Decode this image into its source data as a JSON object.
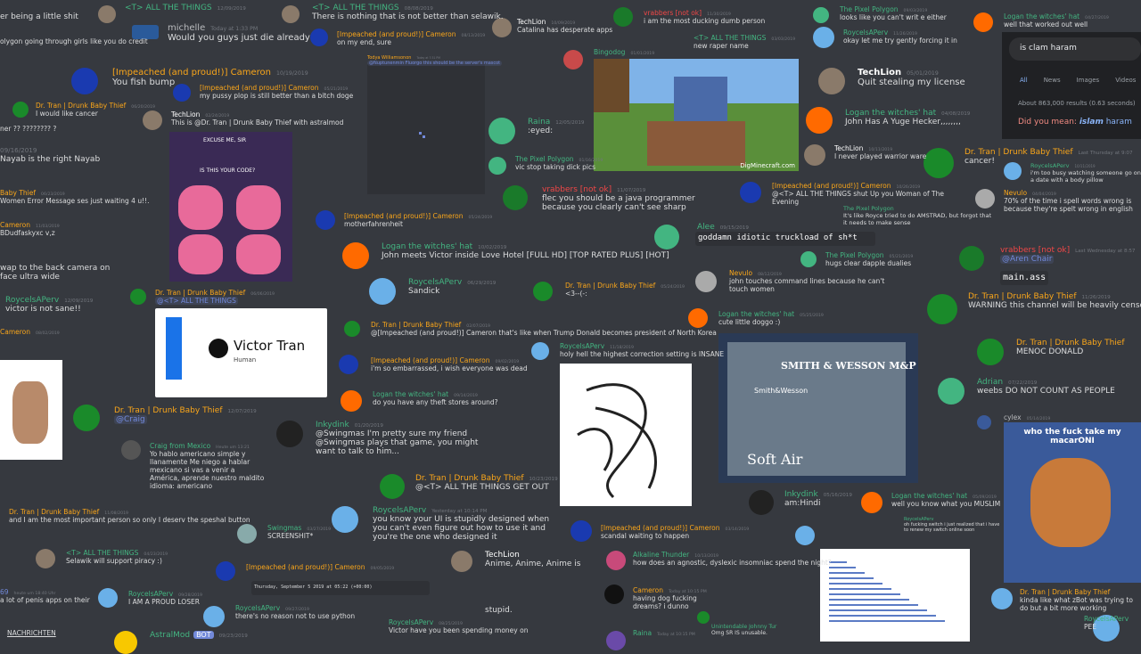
{
  "messages": [
    {
      "id": "m1",
      "name": "",
      "time": "",
      "text": "er being a little shit",
      "color": "#dcddde"
    },
    {
      "id": "m2",
      "name": "",
      "time": "",
      "text": "olygon going through girls like you do credit",
      "color": "#dcddde"
    },
    {
      "id": "m3",
      "name": "<T> ALL THE THINGS",
      "time": "12/09/2019",
      "text": "",
      "color": "#43b581"
    },
    {
      "id": "m4",
      "name": "michelle",
      "time": "Today at 1:33 PM",
      "text": "Would you guys just die already",
      "color": "#b9bbbe"
    },
    {
      "id": "m5",
      "name": "<T> ALL THE THINGS",
      "time": "08/08/2019",
      "text": "There is nothing that is not better than selawik.",
      "color": "#43b581"
    },
    {
      "id": "m6",
      "name": "[Impeached (and proud!)] Cameron",
      "time": "08/13/2019",
      "text": "on my end, sure",
      "color": "#faa61a"
    },
    {
      "id": "m7",
      "name": "TechLion",
      "time": "10/09/2019",
      "text": "Catalina has desperate apps",
      "color": "#ffffff"
    },
    {
      "id": "m8",
      "name": "vrabbers [not ok]",
      "time": "11/30/2019",
      "text": "i am the most ducking dumb person",
      "color": "#f04747"
    },
    {
      "id": "m9",
      "name": "The Pixel Polygon",
      "time": "09/03/2019",
      "text": "looks like you can't writ e either",
      "color": "#43b581"
    },
    {
      "id": "m10",
      "name": "Logan the witches' hat",
      "time": "04/27/2019",
      "text": "well that worked out well",
      "color": "#43b581"
    },
    {
      "id": "m11",
      "name": "<T> ALL THE THINGS",
      "time": "03/03/2019",
      "text": "new raper name",
      "color": "#43b581"
    },
    {
      "id": "m12",
      "name": "RoycelsAPerv",
      "time": "11/26/2019",
      "text": "okay let me try gently forcing it in",
      "color": "#43b581"
    },
    {
      "id": "m13",
      "name": "Todya Williamsonon",
      "time": "Today at 7:31 PM",
      "text": "@Nuptunenmin Fluorgo this should be the server's mascot",
      "color": "#faa61a"
    },
    {
      "id": "m14",
      "name": "Bingodog",
      "time": "01/01/2019",
      "text": "",
      "color": "#43b581"
    },
    {
      "id": "m15",
      "name": "[Impeached (and proud!)] Cameron",
      "time": "10/19/2019",
      "text": "You fish bump",
      "color": "#faa61a"
    },
    {
      "id": "m16",
      "name": "[Impeached (and proud!)] Cameron",
      "time": "05/21/2019",
      "text": "my pussy plop is still better than a bitch doge",
      "color": "#faa61a"
    },
    {
      "id": "m17",
      "name": "TechLion",
      "time": "05/01/2019",
      "text": "Quit stealing my license",
      "color": "#ffffff"
    },
    {
      "id": "m18",
      "name": "Dr. Tran | Drunk Baby Thief",
      "time": "06/20/2019",
      "text": "I would like cancer",
      "color": "#faa61a"
    },
    {
      "id": "m19",
      "name": "TechLion",
      "time": "02/24/2019",
      "text": "This is @Dr. Tran | Drunk Baby Thief with astralmod",
      "color": "#ffffff"
    },
    {
      "id": "m20",
      "name": "Raina",
      "time": "12/05/2019",
      "text": ":eyed:",
      "color": "#43b581"
    },
    {
      "id": "m21",
      "name": "Logan the witches' hat",
      "time": "04/08/2019",
      "text": "John Has A Yuge Hecker,,,,,,,,",
      "color": "#43b581"
    },
    {
      "id": "m22",
      "name": "",
      "time": "",
      "text": "ner ?? ???????? ?",
      "color": "#dcddde"
    },
    {
      "id": "m23",
      "name": "The Pixel Polygon",
      "time": "01/16/2019",
      "text": "vic stop taking dick pics",
      "color": "#43b581"
    },
    {
      "id": "m24",
      "name": "TechLion",
      "time": "10/11/2019",
      "text": "I never played warrior ware",
      "color": "#ffffff"
    },
    {
      "id": "m25",
      "name": "Dr. Tran | Drunk Baby Thief",
      "time": "Last Thursday at 9:07",
      "text": "cancer!",
      "color": "#faa61a"
    },
    {
      "id": "m26",
      "name": "",
      "time": "09/16/2019",
      "text": "Nayab is the right Nayab",
      "color": "#dcddde"
    },
    {
      "id": "m27",
      "name": "RoycelsAPerv",
      "time": "10/11/2019",
      "text": "i'm too busy watching someone go on a date with a body pillow",
      "color": "#43b581"
    },
    {
      "id": "m28",
      "name": "vrabbers [not ok]",
      "time": "11/07/2019",
      "text": "flec you should be a java programmer because you clearly can't see sharp",
      "color": "#f04747"
    },
    {
      "id": "m29",
      "name": "[Impeached (and proud!)] Cameron",
      "time": "10/26/2019",
      "text": "@<T> ALL THE THINGS shut Up you Woman of The Evening",
      "color": "#faa61a"
    },
    {
      "id": "m30",
      "name": "Nevulo",
      "time": "04/04/2019",
      "text": "70% of the time i spell words wrong is because they're spelt wrong in english",
      "color": "#faa61a"
    },
    {
      "id": "m31",
      "name": "Baby Thief",
      "time": "06/23/2019",
      "text": "Women Error Message ses just waiting 4 u!!.",
      "color": "#faa61a"
    },
    {
      "id": "m32",
      "name": "The Pixel Polygon",
      "time": "",
      "text": "It's like Royce tried to do AMSTRAD, but forgot that it needs to make sense",
      "color": "#43b581"
    },
    {
      "id": "m33",
      "name": "Cameron",
      "time": "11/03/2019",
      "text": "BDudfaskyxc v,z",
      "color": "#faa61a"
    },
    {
      "id": "m34",
      "name": "[Impeached (and proud!)] Cameron",
      "time": "05/24/2019",
      "text": "motherfahrenheit",
      "color": "#faa61a"
    },
    {
      "id": "m35",
      "name": "Alee",
      "time": "09/15/2019",
      "text": "goddamn idiotic truckload of sh*t",
      "color": "#43b581"
    },
    {
      "id": "m36",
      "name": "Logan the witches' hat",
      "time": "10/02/2019",
      "text": "John meets Victor inside Love Hotel [FULL HD] [TOP RATED PLUS] [HOT]",
      "color": "#43b581"
    },
    {
      "id": "m37",
      "name": "vrabbers [not ok]",
      "time": "Last Wednesday at 8:57",
      "text": "@Aren Chair",
      "color": "#f04747"
    },
    {
      "id": "m38",
      "name": "",
      "time": "",
      "text": "wap to the back camera on face ultra wide",
      "color": "#dcddde"
    },
    {
      "id": "m39",
      "name": "The Pixel Polygon",
      "time": "05/21/2019",
      "text": "hugs clear dapple dualies",
      "color": "#43b581"
    },
    {
      "id": "m40",
      "name": "Nevulo",
      "time": "08/12/2019",
      "text": "john touches command lines because he can't touch women",
      "color": "#faa61a"
    },
    {
      "id": "m41",
      "name": "RoycelsAPerv",
      "time": "06/29/2019",
      "text": "Sandick",
      "color": "#43b581"
    },
    {
      "id": "m42",
      "name": "Dr. Tran | Drunk Baby Thief",
      "time": "05/24/2019",
      "text": "<3--(-:",
      "color": "#faa61a"
    },
    {
      "id": "m43",
      "name": "Dr. Tran | Drunk Baby Thief",
      "time": "11/26/2019",
      "text": "WARNING this channel will be heavily censored",
      "color": "#faa61a"
    },
    {
      "id": "m44",
      "name": "RoycelsAPerv",
      "time": "12/09/2019",
      "text": "victor is not sane!!",
      "color": "#43b581"
    },
    {
      "id": "m45",
      "name": "Dr. Tran | Drunk Baby Thief",
      "time": "06/06/2019",
      "text": "@<T> ALL THE THINGS",
      "color": "#faa61a"
    },
    {
      "id": "m46",
      "name": "Logan the witches' hat",
      "time": "05/25/2019",
      "text": "cute little doggo :)",
      "color": "#43b581"
    },
    {
      "id": "m47",
      "name": "Dr. Tran | Drunk Baby Thief",
      "time": "02/07/2019",
      "text": "@[Impeached (and proud!)] Cameron that's like when Trump Donald becomes president of North Korea",
      "color": "#faa61a"
    },
    {
      "id": "m48",
      "name": "Cameron",
      "time": "08/02/2019",
      "text": "",
      "color": "#faa61a"
    },
    {
      "id": "m49",
      "name": "Dr. Tran | Drunk Baby Thief",
      "time": "",
      "text": "MENOC DONALD",
      "color": "#faa61a"
    },
    {
      "id": "m50",
      "name": "RoycelsAPerv",
      "time": "11/18/2019",
      "text": "holy hell the highest correction setting is INSANE",
      "color": "#43b581"
    },
    {
      "id": "m51",
      "name": "[Impeached (and proud!)] Cameron",
      "time": "09/02/2019",
      "text": "i'm so embarrassed, i wish everyone was dead",
      "color": "#faa61a"
    },
    {
      "id": "m52",
      "name": "Adrian",
      "time": "07/22/2019",
      "text": "weebs DO NOT COUNT AS PEOPLE",
      "color": "#43b581"
    },
    {
      "id": "m53",
      "name": "Logan the witches' hat",
      "time": "09/14/2019",
      "text": "do you have any theft stores around?",
      "color": "#43b581"
    },
    {
      "id": "m54",
      "name": "cylex",
      "time": "05/14/2019",
      "text": "",
      "color": "#b9bbbe"
    },
    {
      "id": "m55",
      "name": "Dr. Tran | Drunk Baby Thief",
      "time": "12/07/2019",
      "text": "@Craig",
      "color": "#faa61a"
    },
    {
      "id": "m56",
      "name": "Inkydink",
      "time": "01/20/2019",
      "text": "@Swingmas I'm pretty sure my friend @Swingmas plays that game, you might want to talk to him...",
      "color": "#43b581"
    },
    {
      "id": "m57",
      "name": "Craig from Mexico",
      "time": "Heute um 13:21",
      "text": "Yo hablo americano simple y llanamente Me niego a hablar mexicano si vas a venir a América, aprende nuestro maldito idioma: americano",
      "color": "#43b581"
    },
    {
      "id": "m58",
      "name": "Dr. Tran | Drunk Baby Thief",
      "time": "10/23/2019",
      "text": "@<T> ALL THE THINGS GET OUT",
      "color": "#faa61a"
    },
    {
      "id": "m59",
      "name": "Inkydink",
      "time": "05/16/2019",
      "text": "am:Hindi",
      "color": "#43b581"
    },
    {
      "id": "m60",
      "name": "Logan the witches' hat",
      "time": "05/09/2019",
      "text": "well you know what you MUSLIM",
      "color": "#43b581"
    },
    {
      "id": "m61",
      "name": "Dr. Tran | Drunk Baby Thief",
      "time": "11/08/2019",
      "text": "and I am the most important person so only I deserv the speshal button",
      "color": "#faa61a"
    },
    {
      "id": "m62",
      "name": "RoycelsAPerv",
      "time": "Yesterday at 10:14 PM",
      "text": "you know your UI is stupidly designed when you can't even figure out how to use it and you're the one who designed it",
      "color": "#43b581"
    },
    {
      "id": "m63",
      "name": "Swingmas",
      "time": "03/27/2019",
      "text": "SCREENSHIT*",
      "color": "#43b581"
    },
    {
      "id": "m64",
      "name": "[Impeached (and proud!)] Cameron",
      "time": "03/14/2019",
      "text": "scandal waiting to happen",
      "color": "#faa61a"
    },
    {
      "id": "m65",
      "name": "RoycelsAPerv",
      "time": "",
      "text": "oh fucking switch i just realized that i have to renew my switch online soon",
      "color": "#43b581"
    },
    {
      "id": "m66",
      "name": "<T> ALL THE THINGS",
      "time": "04/23/2019",
      "text": "Selawik will support piracy :)",
      "color": "#43b581"
    },
    {
      "id": "m67",
      "name": "[Impeached (and proud!)] Cameron",
      "time": "09/05/2019",
      "text": "",
      "color": "#faa61a"
    },
    {
      "id": "m68",
      "name": "TechLion",
      "time": "",
      "text": "Anime, Anime, Anime is",
      "color": "#ffffff"
    },
    {
      "id": "m69",
      "name": "Alkaline Thunder",
      "time": "10/13/2019",
      "text": "how does an agnostic, dyslexic insomniac spend the night?",
      "color": "#43b581"
    },
    {
      "id": "m70",
      "name": "Dr. Tran | Drunk Baby Thief",
      "time": "",
      "text": "kinda like what zBot was trying to do but a bit more working",
      "color": "#faa61a"
    },
    {
      "id": "m71",
      "name": "",
      "time": "heute um 18:40 Uhr",
      "text": "a lot of penis apps on their",
      "color": "#dcddde"
    },
    {
      "id": "m72",
      "name": "RoycelsAPerv",
      "time": "09/28/2019",
      "text": "I AM A PROUD LOSER",
      "color": "#43b581"
    },
    {
      "id": "m73",
      "name": "RoycelsAPerv",
      "time": "09/27/2019",
      "text": "there's no reason not to use python",
      "color": "#43b581"
    },
    {
      "id": "m74",
      "name": "",
      "time": "",
      "text": "stupid.",
      "color": "#dcddde"
    },
    {
      "id": "m75",
      "name": "Cameron",
      "time": "Today at 10:15 PM",
      "text": "having dog fucking dreams? i dunno",
      "color": "#faa61a"
    },
    {
      "id": "m76",
      "name": "Unintendable Johnny Tur",
      "time": "",
      "text": "Omg SR IS unusable.",
      "color": "#43b581"
    },
    {
      "id": "m77",
      "name": "RoycelsAPerv",
      "time": "",
      "text": "PEE",
      "color": "#43b581"
    },
    {
      "id": "m78",
      "name": "AstralMod",
      "time": "09/23/2019",
      "text": "",
      "color": "#43b581"
    },
    {
      "id": "m79",
      "name": "RoycelsAPerv",
      "time": "08/25/2019",
      "text": "Victor have you been spending money on",
      "color": "#43b581"
    },
    {
      "id": "m80",
      "name": "Raina",
      "time": "Today at 10:15 PM",
      "text": "",
      "color": "#43b581"
    },
    {
      "id": "m81",
      "name": "",
      "time": "",
      "text": "NACHRICHTEN",
      "color": "#dcddde"
    }
  ],
  "google": {
    "query": "is clam haram",
    "tabs": [
      "All",
      "News",
      "Images",
      "Videos"
    ],
    "results": "About 863,000 results (0.63 seconds)",
    "didyoumean_prefix": "Did you mean:",
    "didyoumean_bold": "islam",
    "didyoumean_suffix": "haram"
  },
  "cards": {
    "victor_name": "Victor Tran",
    "victor_sub": "Human",
    "minecraft_watermark": "DigMinecraft.com",
    "gun_brand": "SMITH & WESSON M&P",
    "gun_sub": "Smith&Wesson",
    "gun_soft": "Soft Air",
    "meme_text": "who the fuck take my macarONI",
    "patrick_caption": "EXCUSE ME, SIR",
    "patrick_q": "IS THIS YOUR CODE?",
    "main_ass": "main.ass",
    "astral_bot": "BOT",
    "code_snip": "Thursday, September 5 2019 at 05:22 (+00:00)",
    "alee_code": "goddamn idiotic truckload of sh*t"
  }
}
